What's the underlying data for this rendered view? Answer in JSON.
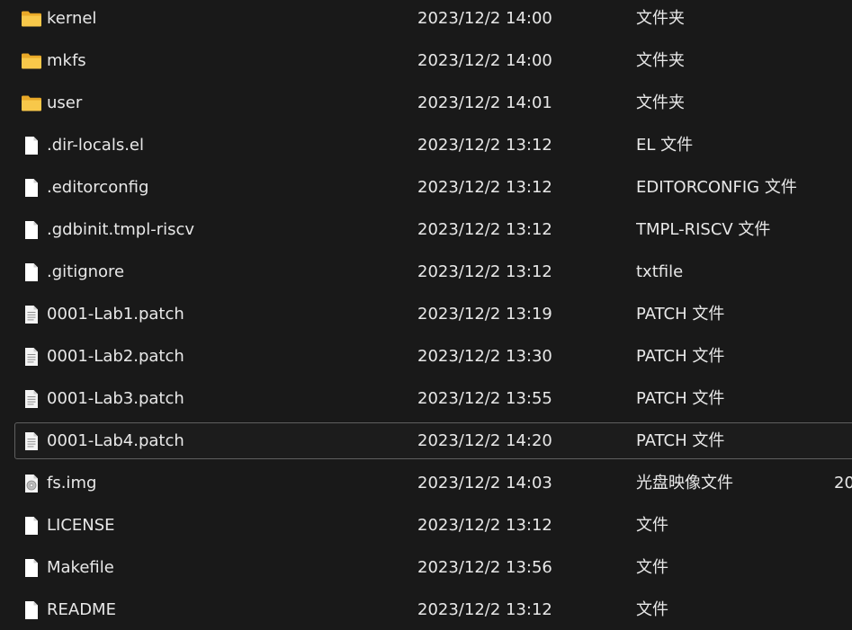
{
  "files": [
    {
      "name": "kernel",
      "modified": "2023/12/2 14:00",
      "type": "文件夹",
      "size": "",
      "icon": "folder-icon"
    },
    {
      "name": "mkfs",
      "modified": "2023/12/2 14:00",
      "type": "文件夹",
      "size": "",
      "icon": "folder-icon"
    },
    {
      "name": "user",
      "modified": "2023/12/2 14:01",
      "type": "文件夹",
      "size": "",
      "icon": "folder-icon"
    },
    {
      "name": ".dir-locals.el",
      "modified": "2023/12/2 13:12",
      "type": "EL 文件",
      "size": "",
      "icon": "file-icon"
    },
    {
      "name": ".editorconfig",
      "modified": "2023/12/2 13:12",
      "type": "EDITORCONFIG 文件",
      "size": "",
      "icon": "file-icon"
    },
    {
      "name": ".gdbinit.tmpl-riscv",
      "modified": "2023/12/2 13:12",
      "type": "TMPL-RISCV 文件",
      "size": "",
      "icon": "file-icon"
    },
    {
      "name": ".gitignore",
      "modified": "2023/12/2 13:12",
      "type": "txtfile",
      "size": "",
      "icon": "file-icon"
    },
    {
      "name": "0001-Lab1.patch",
      "modified": "2023/12/2 13:19",
      "type": "PATCH 文件",
      "size": "",
      "icon": "text-file-icon"
    },
    {
      "name": "0001-Lab2.patch",
      "modified": "2023/12/2 13:30",
      "type": "PATCH 文件",
      "size": "",
      "icon": "text-file-icon"
    },
    {
      "name": "0001-Lab3.patch",
      "modified": "2023/12/2 13:55",
      "type": "PATCH 文件",
      "size": "",
      "icon": "text-file-icon"
    },
    {
      "name": "0001-Lab4.patch",
      "modified": "2023/12/2 14:20",
      "type": "PATCH 文件",
      "size": "",
      "icon": "text-file-icon",
      "selected": true
    },
    {
      "name": "fs.img",
      "modified": "2023/12/2 14:03",
      "type": "光盘映像文件",
      "size": "20",
      "icon": "disc-image-icon"
    },
    {
      "name": "LICENSE",
      "modified": "2023/12/2 13:12",
      "type": "文件",
      "size": "",
      "icon": "file-icon"
    },
    {
      "name": "Makefile",
      "modified": "2023/12/2 13:56",
      "type": "文件",
      "size": "",
      "icon": "file-icon"
    },
    {
      "name": "README",
      "modified": "2023/12/2 13:12",
      "type": "文件",
      "size": "",
      "icon": "file-icon"
    }
  ],
  "colors": {
    "background": "#191919",
    "text": "#e8e8e8",
    "folder": "#f8c84a",
    "selection_border": "#5f5f5f"
  }
}
